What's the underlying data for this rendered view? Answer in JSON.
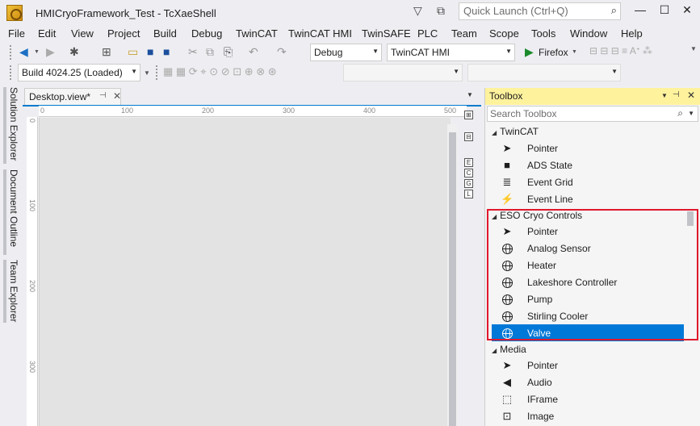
{
  "window": {
    "title": "HMICryoFramework_Test - TcXaeShell",
    "min_icon": "minimize-icon",
    "max_icon": "maximize-icon",
    "close_icon": "close-icon"
  },
  "quick_launch": {
    "placeholder": "Quick Launch (Ctrl+Q)"
  },
  "menu": [
    "File",
    "Edit",
    "View",
    "Project",
    "Build",
    "Debug",
    "TwinCAT",
    "TwinCAT HMI",
    "TwinSAFE",
    "PLC",
    "Team",
    "Scope",
    "Tools",
    "Window",
    "Help"
  ],
  "toolbar": {
    "config": "Debug",
    "platform": "TwinCAT HMI",
    "run_target": "Firefox",
    "build_combo": "Build 4024.25 (Loaded)"
  },
  "side_tabs": [
    "Solution Explorer",
    "Document Outline",
    "Team Explorer"
  ],
  "document": {
    "tab_label": "Desktop.view*",
    "ruler_h": [
      "0",
      "100",
      "200",
      "300",
      "400",
      "500"
    ],
    "ruler_v": [
      "0",
      "100",
      "200",
      "300"
    ],
    "side_buttons": [
      "E",
      "C",
      "G",
      "L"
    ]
  },
  "toolbox": {
    "title": "Toolbox",
    "search_placeholder": "Search Toolbox",
    "groups": [
      {
        "name": "TwinCAT",
        "items": [
          {
            "label": "Pointer",
            "icon": "pointer-icon"
          },
          {
            "label": "ADS State",
            "icon": "square-icon"
          },
          {
            "label": "Event Grid",
            "icon": "event-grid-icon"
          },
          {
            "label": "Event Line",
            "icon": "event-line-icon"
          }
        ]
      },
      {
        "name": "ESO Cryo Controls",
        "items": [
          {
            "label": "Pointer",
            "icon": "pointer-icon"
          },
          {
            "label": "Analog Sensor",
            "icon": "globe-icon"
          },
          {
            "label": "Heater",
            "icon": "globe-icon"
          },
          {
            "label": "Lakeshore Controller",
            "icon": "globe-icon"
          },
          {
            "label": "Pump",
            "icon": "globe-icon"
          },
          {
            "label": "Stirling Cooler",
            "icon": "globe-icon"
          },
          {
            "label": "Valve",
            "icon": "globe-icon",
            "selected": true
          }
        ]
      },
      {
        "name": "Media",
        "items": [
          {
            "label": "Pointer",
            "icon": "pointer-icon"
          },
          {
            "label": "Audio",
            "icon": "speaker-icon"
          },
          {
            "label": "IFrame",
            "icon": "iframe-icon"
          },
          {
            "label": "Image",
            "icon": "image-icon"
          }
        ]
      }
    ]
  },
  "colors": {
    "accent": "#007acc",
    "selection": "#0078d7",
    "highlight_box": "#e0182d",
    "toolbox_header": "#fff29d"
  }
}
